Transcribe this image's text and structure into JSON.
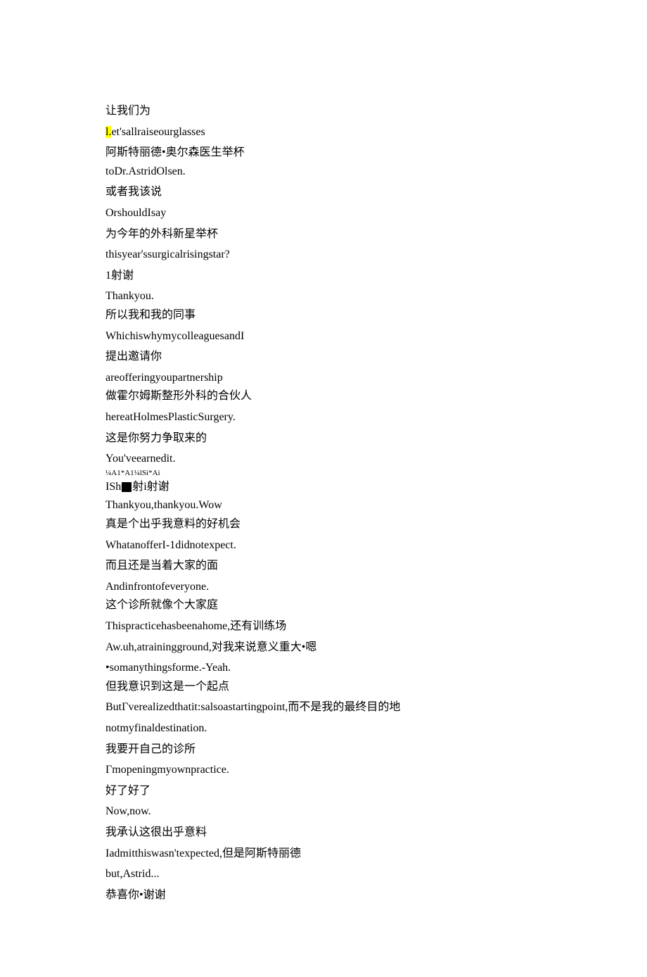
{
  "lines": [
    {
      "text": "让我们为",
      "cls": "chn"
    },
    {
      "text": "et'sallraiseourglasses",
      "cls": "eng",
      "prefix": {
        "text": "l.",
        "highlight": true
      }
    },
    {
      "text": "阿斯特丽德•奥尔森医生举杯",
      "cls": "chn tight"
    },
    {
      "text": "toDr.AstridOlsen.",
      "cls": "eng"
    },
    {
      "text": "或者我该说",
      "cls": "chn"
    },
    {
      "text": "OrshouldIsay",
      "cls": "eng"
    },
    {
      "text": "为今年的外科新星举杯",
      "cls": "chn"
    },
    {
      "text": "thisyear'ssurgicalrisingstar?",
      "cls": "eng"
    },
    {
      "text": "1射谢",
      "cls": "chn"
    },
    {
      "text": "Thankyou.",
      "cls": "eng tight"
    },
    {
      "text": "所以我和我的同事",
      "cls": "chn"
    },
    {
      "text": "WhichiswhymycolleaguesandI",
      "cls": "eng"
    },
    {
      "text": "提出邀请你",
      "cls": "chn"
    },
    {
      "text": "areofferingyoupartnership",
      "cls": "eng tight"
    },
    {
      "text": "做霍尔姆斯整形外科的合伙人",
      "cls": "chn"
    },
    {
      "text": "hereatHolmesPlasticSurgery.",
      "cls": "eng"
    },
    {
      "text": "这是你努力争取来的",
      "cls": "chn"
    },
    {
      "text": "You'veearnedit.",
      "cls": "eng tight"
    },
    {
      "text": "¼A1*A1¼lSi*Ai",
      "cls": "small-line"
    },
    {
      "text": "射i射谢",
      "cls": "eng tight",
      "prefixBox": true,
      "boxPrefix": "ISh"
    },
    {
      "text": "Thankyou,thankyou.Wow",
      "cls": "eng tight"
    },
    {
      "text": "真是个出乎我意料的好机会",
      "cls": "chn"
    },
    {
      "text": "WhatanofferI-1didnotexpect.",
      "cls": "eng"
    },
    {
      "text": "而且还是当着大家的面",
      "cls": "chn"
    },
    {
      "text": "Andinfrontofeveryone.",
      "cls": "eng tight"
    },
    {
      "text": "这个诊所就像个大家庭",
      "cls": "chn"
    },
    {
      "text": "Thispracticehasbeenahome,还有训练场",
      "cls": "eng"
    },
    {
      "text": "Aw.uh,atrainingground,对我来说意义重大•嗯",
      "cls": "eng"
    },
    {
      "text": "•somanythingsforme.-Yeah.",
      "cls": "eng tight"
    },
    {
      "text": "但我意识到这是一个起点",
      "cls": "chn"
    },
    {
      "text": "ButΓverealizedthatit:salsoastartingpoint,而不是我的最终目的地",
      "cls": "eng"
    },
    {
      "text": "notmyfinaldestination.",
      "cls": "eng"
    },
    {
      "text": "我要开自己的诊所",
      "cls": "chn"
    },
    {
      "text": "Γmopeningmyownpractice.",
      "cls": "eng"
    },
    {
      "text": "好了好了",
      "cls": "chn"
    },
    {
      "text": "Now,now.",
      "cls": "eng"
    },
    {
      "text": "我承认这很出乎意料",
      "cls": "chn"
    },
    {
      "text": "Iadmitthiswasn'texpected,但是阿斯特丽德",
      "cls": "eng"
    },
    {
      "text": "but,Astrid...",
      "cls": "eng"
    },
    {
      "text": "恭喜你•谢谢",
      "cls": "chn"
    }
  ]
}
